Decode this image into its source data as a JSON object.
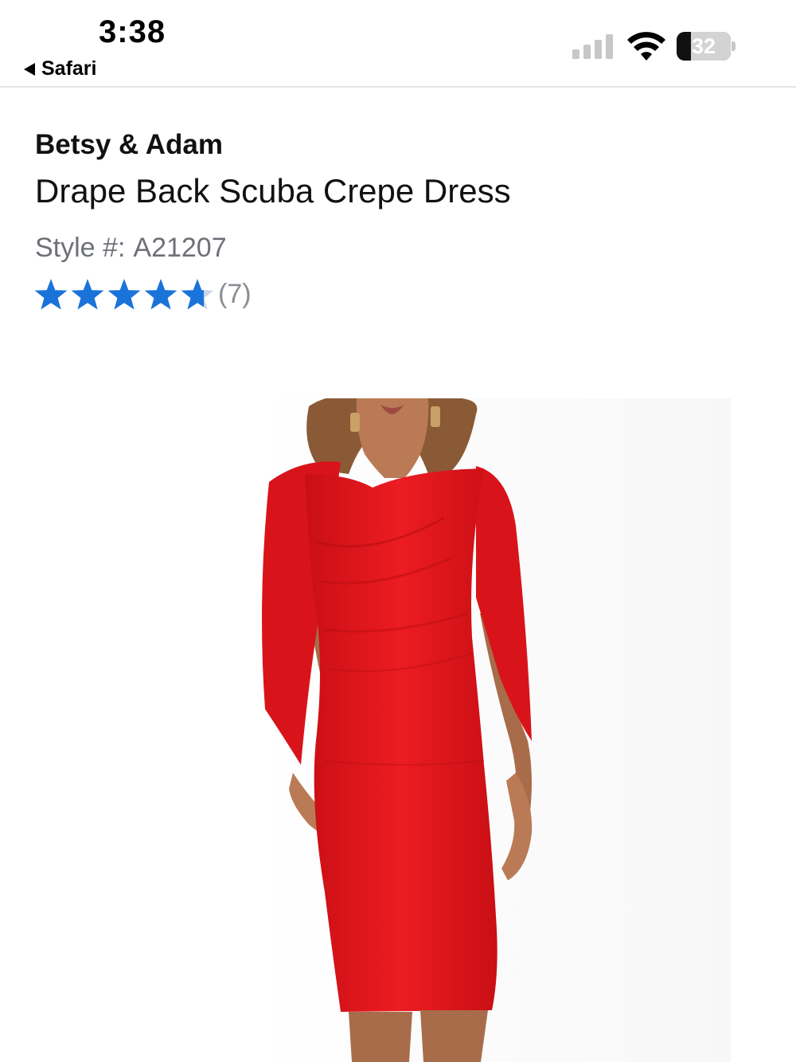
{
  "status_bar": {
    "time": "3:38",
    "back_label": "Safari",
    "battery_percent": "32",
    "icons": [
      "back-arrow-icon",
      "cellular-signal-icon",
      "wifi-icon",
      "battery-icon"
    ]
  },
  "product": {
    "brand": "Betsy & Adam",
    "name": "Drape Back Scuba Crepe Dress",
    "style_label": "Style #:",
    "style_number": "A21207",
    "rating": 4.7,
    "rating_max": 5,
    "review_count": "(7)",
    "image_alt": "Red cape-sleeve sheath dress worn by model"
  },
  "colors": {
    "star": "#1a73d9",
    "star_empty": "#c9d6e8",
    "dress": "#e3161c",
    "muted_text": "#6e7079"
  }
}
